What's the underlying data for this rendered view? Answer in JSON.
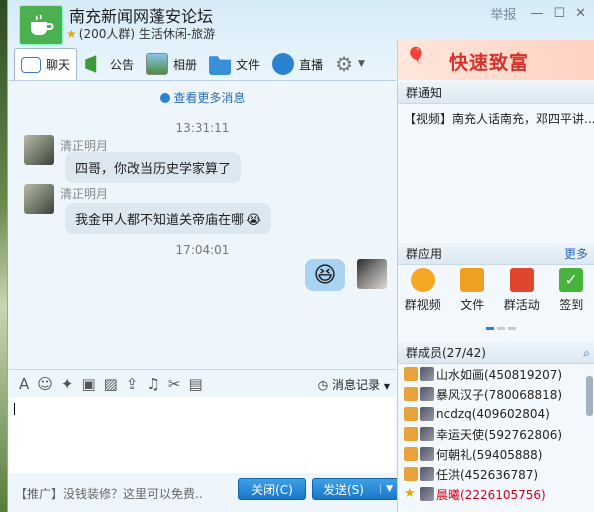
{
  "header": {
    "title": "南充新闻网蓬安论坛",
    "subtitle": "(200人群) 生活休闲-旅游",
    "report": "举报"
  },
  "toolbar": {
    "tabs": [
      {
        "label": "聊天",
        "icon": "chat-icon"
      },
      {
        "label": "公告",
        "icon": "announcement-icon"
      },
      {
        "label": "相册",
        "icon": "album-icon"
      },
      {
        "label": "文件",
        "icon": "folder-icon"
      },
      {
        "label": "直播",
        "icon": "live-icon"
      }
    ]
  },
  "chat": {
    "more_messages": "查看更多消息",
    "time1": "13:31:11",
    "msg1": {
      "sender": "清正明月",
      "text": "四哥，你改当历史学家算了"
    },
    "msg2": {
      "sender": "清正明月",
      "text": "我金甲人都不知道关帝庙在哪"
    },
    "msg2_emoji": "😭",
    "time2": "17:04:01",
    "my_emoji": "😆"
  },
  "input": {
    "message_record": "消息记录"
  },
  "bottom": {
    "promo": "【推广】没钱装修？这里可以免费..",
    "close_label": "关闭(C)",
    "send_label": "发送(S)"
  },
  "ad": {
    "text": "快速致富"
  },
  "notice": {
    "heading": "群通知",
    "text": "【视频】南充人话南充，邓四平讲..."
  },
  "apps": {
    "heading": "群应用",
    "more": "更多",
    "items": [
      {
        "label": "群视频",
        "color": "#f5a623"
      },
      {
        "label": "文件",
        "color": "#f0a020"
      },
      {
        "label": "群活动",
        "color": "#e0452e"
      },
      {
        "label": "签到",
        "color": "#47b33a"
      }
    ]
  },
  "members": {
    "heading": "群成员(27/42)",
    "list": [
      {
        "name": "山水如画(450819207)",
        "color": "#222"
      },
      {
        "name": "暴风汉子(780068818)",
        "color": "#222"
      },
      {
        "name": "ncdzq(409602804)",
        "color": "#222"
      },
      {
        "name": "幸运天使(592762806)",
        "color": "#222"
      },
      {
        "name": "何朝礼(59405888)",
        "color": "#222"
      },
      {
        "name": "任洪(452636787)",
        "color": "#222"
      },
      {
        "name": "晨曦(2226105756)",
        "color": "#d0021b"
      }
    ]
  }
}
